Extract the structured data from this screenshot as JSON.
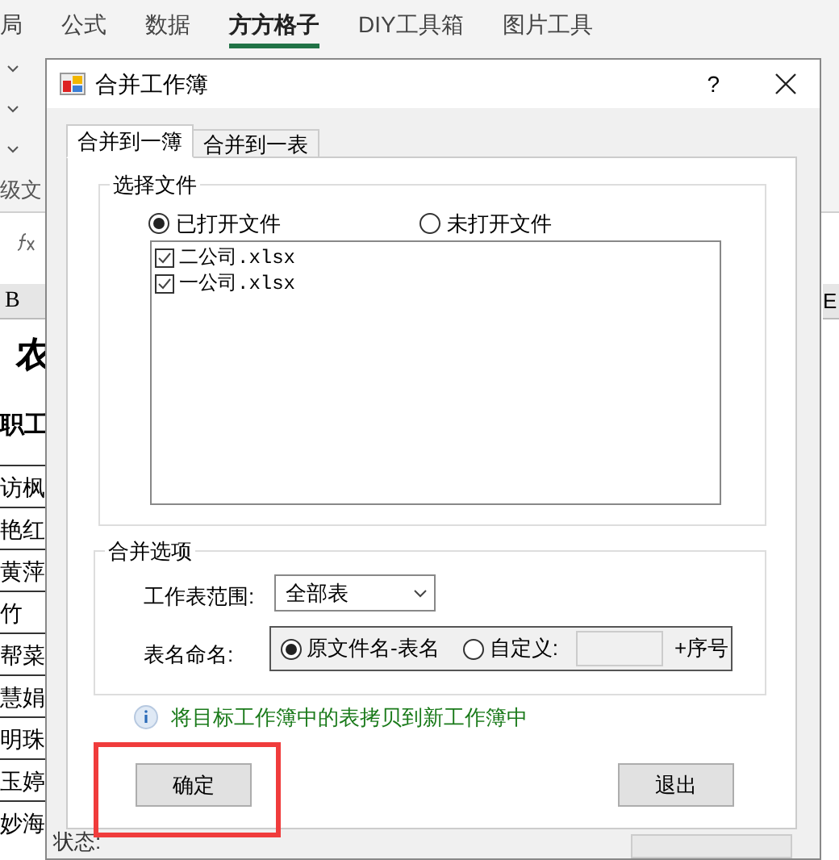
{
  "ribbon_tabs": [
    {
      "label": "局",
      "selected": false
    },
    {
      "label": "公式",
      "selected": false
    },
    {
      "label": "数据",
      "selected": false
    },
    {
      "label": "方方格子",
      "selected": true
    },
    {
      "label": "DIY工具箱",
      "selected": false
    },
    {
      "label": "图片工具",
      "selected": false
    }
  ],
  "ribbon_fragment": "级文",
  "sheet": {
    "column_headers": [
      "B",
      "E"
    ],
    "title_cell": "农",
    "header_cell": "职工",
    "cells": [
      "访枫",
      "艳红",
      "黄萍",
      "竹",
      "帮菜",
      "慧娟",
      "明珠",
      "玉婷",
      "妙海"
    ]
  },
  "dialog": {
    "title": "合并工作簿",
    "help": "?",
    "tabs": [
      {
        "label": "合并到一簿",
        "selected": true
      },
      {
        "label": "合并到一表",
        "selected": false
      }
    ],
    "file_group": {
      "title": "选择文件",
      "sources": [
        {
          "label": "已打开文件",
          "selected": true
        },
        {
          "label": "未打开文件",
          "selected": false
        }
      ],
      "files": [
        {
          "name": "二公司.xlsx",
          "checked": true
        },
        {
          "name": "一公司.xlsx",
          "checked": true
        }
      ]
    },
    "options_group": {
      "title": "合并选项",
      "range_label": "工作表范围:",
      "range_value": "全部表",
      "naming_label": "表名命名:",
      "naming_options": [
        {
          "label": "原文件名-表名",
          "selected": true
        },
        {
          "label": "自定义:",
          "selected": false
        }
      ],
      "suffix": "+序号"
    },
    "info": "将目标工作簿中的表拷贝到新工作簿中",
    "buttons": [
      "确定",
      "退出"
    ],
    "status_label": "状态:"
  }
}
